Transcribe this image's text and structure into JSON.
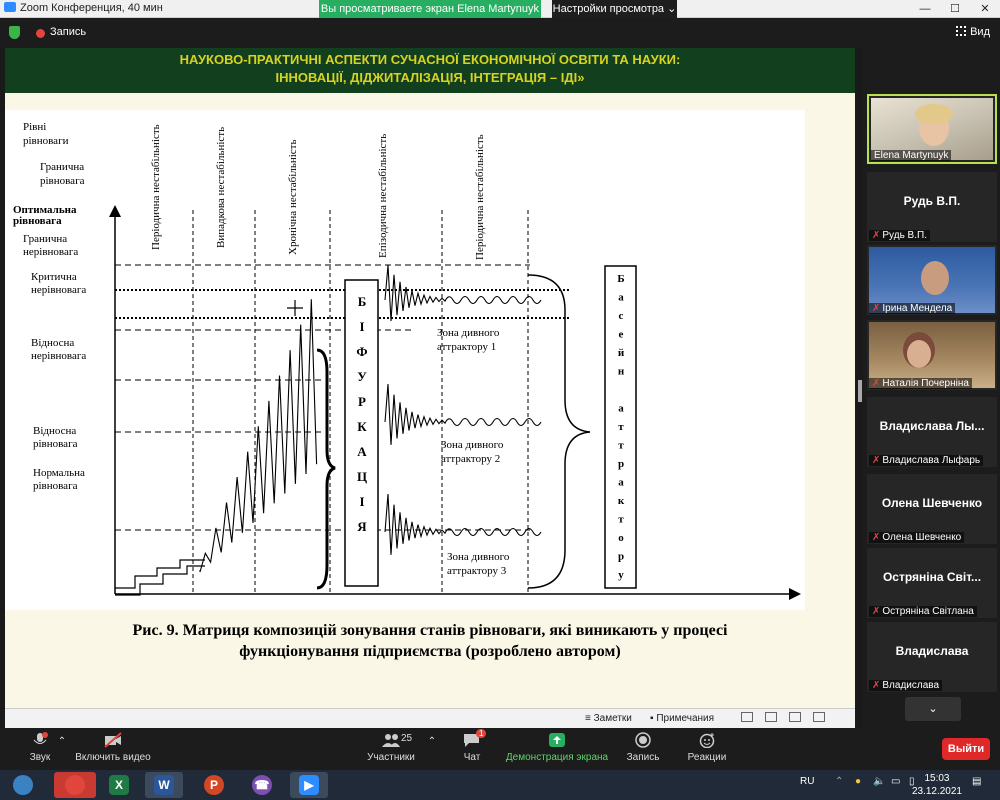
{
  "window": {
    "title": "Zoom Конференция, 40 мин",
    "share_banner": "Вы просматриваете экран Elena Martynuyk",
    "view_options": "Настройки просмотра ⌄",
    "minimize": "—",
    "maximize": "☐",
    "close": "✕"
  },
  "topbar": {
    "record_label": "Запись",
    "view_label": "Вид"
  },
  "slide": {
    "header_line1": "НАУКОВО-ПРАКТИЧНІ АСПЕКТИ СУЧАСНОЇ ЕКОНОМІЧНОЇ ОСВІТИ ТА НАУКИ:",
    "header_line2": "ІННОВАЦІЇ, ДІДЖИТАЛІЗАЦІЯ, ІНТЕГРАЦІЯ – ІДІ»",
    "caption_line1": "Рис. 9. Матриця композицій зонування станів рівноваги, які виникають у процесі",
    "caption_line2": "функціонування підприємства (розроблено автором)",
    "notes": "Заметки",
    "comments": "Примечания"
  },
  "diagram": {
    "y_labels": [
      [
        "Рівні",
        "рівноваги"
      ],
      [
        "Гранична",
        "рівновага"
      ],
      [
        "Оптимальна",
        "рівновага"
      ],
      [
        "Гранична",
        "нерівновага"
      ],
      [
        "Критична",
        "нерівновага"
      ],
      [
        "Відносна",
        "нерівновага"
      ],
      [
        "Відносна",
        "рівновага"
      ],
      [
        "Нормальна",
        "рівновага"
      ]
    ],
    "columns": [
      "Періодична  нестабільність",
      "Випадкова  нестабільність",
      "Хронічна  нестабільність",
      "Епізодична  нестабільність",
      "Періодична  нестабільність"
    ],
    "bifurcation": [
      "Б",
      "І",
      "Ф",
      "У",
      "Р",
      "К",
      "А",
      "Ц",
      "І",
      "Я"
    ],
    "basin": [
      "Б",
      "а",
      "с",
      "е",
      "й",
      "н",
      "",
      "а",
      "т",
      "т",
      "р",
      "а",
      "к",
      "т",
      "о",
      "р",
      "у"
    ],
    "zones": [
      [
        "Зона дивного",
        "аттрактору 1"
      ],
      [
        "Зона дивного",
        "аттрактору 2"
      ],
      [
        "Зона дивного",
        "аттрактору 3"
      ]
    ]
  },
  "participants": [
    {
      "name": "Elena Martynuyk",
      "display": ""
    },
    {
      "name": "Рудь В.П.",
      "display": "Рудь В.П."
    },
    {
      "name": "Ірина Менделa",
      "display": ""
    },
    {
      "name": "Наталія Почерніна",
      "display": ""
    },
    {
      "name": "Владислава Лыфарь",
      "display": "Владислава  Лы..."
    },
    {
      "name": "Олена Шевченко",
      "display": "Олена Шевченко"
    },
    {
      "name": "Остряніна Світлана",
      "display": "Остряніна  Світ..."
    },
    {
      "name": "Владислава",
      "display": "Владислава"
    }
  ],
  "toolbar": {
    "audio": "Звук",
    "video": "Включить видео",
    "participants": "Участники",
    "participants_count": "25",
    "chat": "Чат",
    "chat_badge": "1",
    "share": "Демонстрация экрана",
    "record": "Запись",
    "reactions": "Реакции",
    "exit": "Выйти"
  },
  "taskbar": {
    "lang": "RU",
    "time": "15:03",
    "date": "23.12.2021"
  }
}
